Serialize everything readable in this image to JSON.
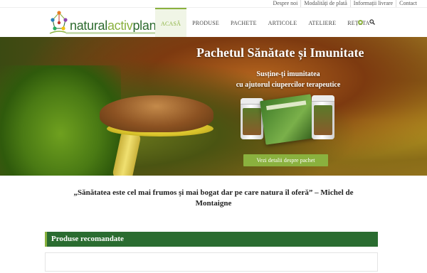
{
  "topbar": {
    "links": [
      "Despre noi",
      "Modalități de plată",
      "Informații livrare",
      "Contact"
    ]
  },
  "logo": {
    "text_part1": "natural",
    "text_part2": "activ",
    "text_part3": "plant"
  },
  "nav": {
    "items": [
      "ACASĂ",
      "PRODUSE",
      "PACHETE",
      "ARTICOLE",
      "ATELIERE",
      "REȚETA"
    ],
    "active_index": 0
  },
  "colors": {
    "brand_green": "#2a6c30",
    "accent_green": "#8ab13e"
  },
  "hero": {
    "title": "Pachetul Sănătate și Imunitate",
    "subtitle_line1": "Susține-ți imunitatea",
    "subtitle_line2": "cu ajutorul ciupercilor terapeutice",
    "button_label": "Vezi detalii despre pachet"
  },
  "quote": {
    "text": "„Sănătatea este cel mai frumos și mai bogat dar pe care natura îl oferă” – Michel de Montaigne"
  },
  "recommended": {
    "title": "Produse recomandate"
  },
  "icons": {
    "nav_cart": "leaf-circle-icon",
    "nav_search": "search-icon"
  }
}
